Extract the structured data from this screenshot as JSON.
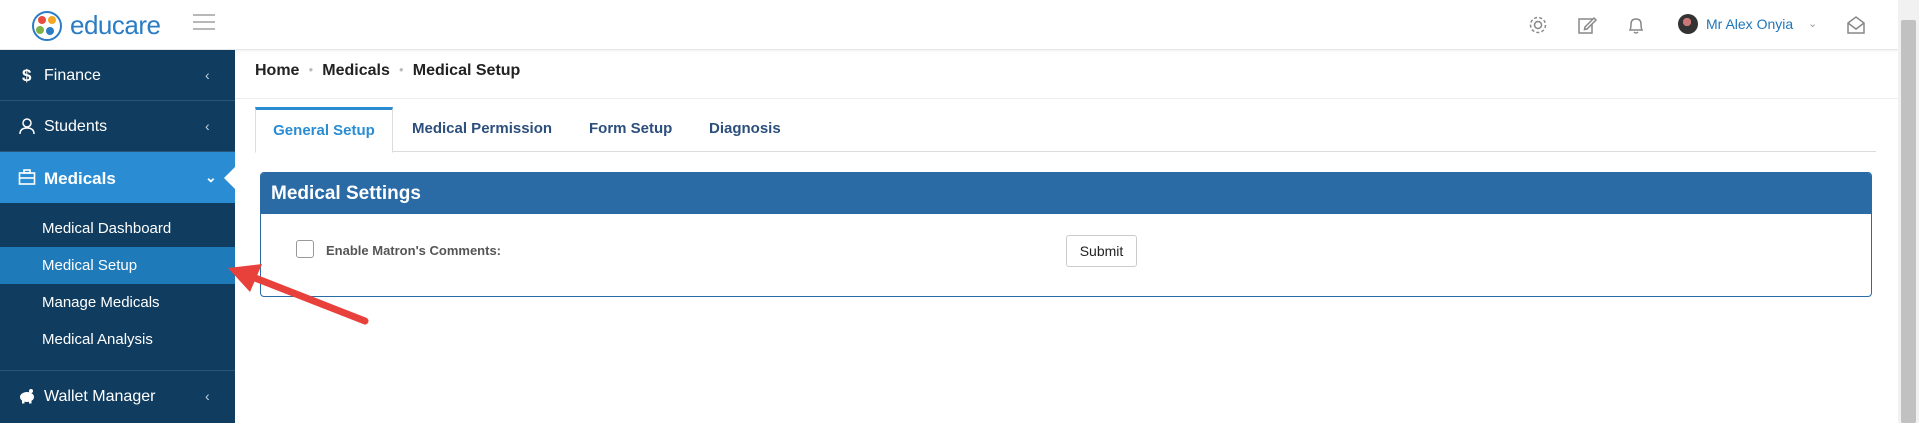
{
  "app": {
    "logo_text": "educare"
  },
  "header": {
    "user_name": "Mr Alex Onyia",
    "icons": [
      "gear-icon",
      "edit-icon",
      "bell-icon",
      "mail-open-icon"
    ]
  },
  "sidebar": {
    "items": [
      {
        "label": "Finance",
        "icon": "dollar-icon"
      },
      {
        "label": "Students",
        "icon": "user-icon"
      },
      {
        "label": "Medicals",
        "icon": "briefcase-icon",
        "active": true
      },
      {
        "label": "Wallet Manager",
        "icon": "piggy-bank-icon"
      }
    ],
    "sub_items": [
      {
        "label": "Medical Dashboard"
      },
      {
        "label": "Medical Setup",
        "active": true
      },
      {
        "label": "Manage Medicals"
      },
      {
        "label": "Medical Analysis"
      }
    ]
  },
  "breadcrumb": [
    "Home",
    "Medicals",
    "Medical Setup"
  ],
  "tabs": [
    {
      "label": "General Setup",
      "active": true
    },
    {
      "label": "Medical Permission"
    },
    {
      "label": "Form Setup"
    },
    {
      "label": "Diagnosis"
    }
  ],
  "panel": {
    "title": "Medical Settings",
    "checkbox_label": "Enable Matron's Comments:",
    "checkbox_checked": false,
    "submit_label": "Submit"
  },
  "colors": {
    "sidebar_bg": "#0f3c5f",
    "sidebar_active": "#2a8dd4",
    "panel_header": "#2a6ba6",
    "brand": "#2a7dc4",
    "annotation_arrow": "#e8413c"
  }
}
